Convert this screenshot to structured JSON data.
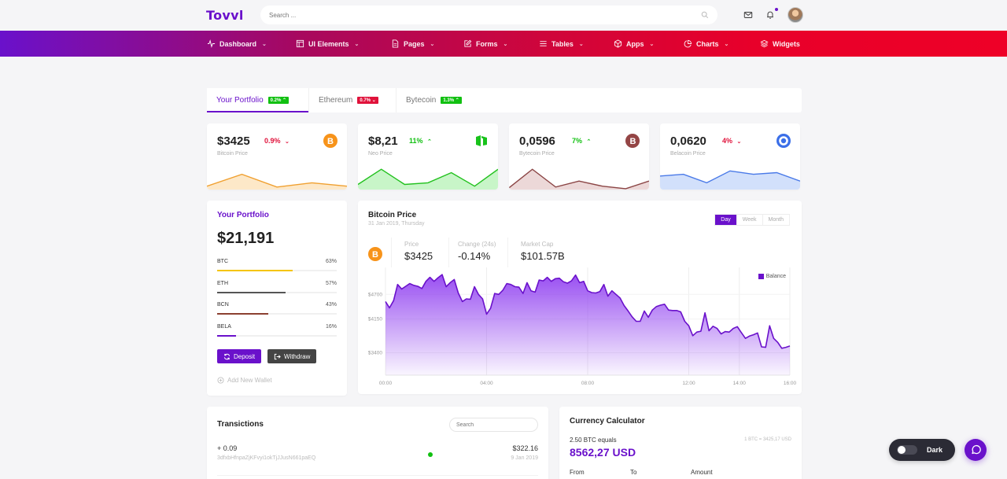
{
  "app": {
    "logo": "Tovvl"
  },
  "search": {
    "placeholder": "Search ..."
  },
  "colors": {
    "primary": "#6a11cb",
    "green": "#11c011",
    "red": "#e0123b",
    "btc": "#f7931a",
    "neo": "#18c21b",
    "bcn": "#944545",
    "bela": "#3b6fe8"
  },
  "nav": [
    {
      "label": "Dashboard",
      "icon": "activity-icon",
      "chevron": true
    },
    {
      "label": "UI Elements",
      "icon": "layout-icon",
      "chevron": true
    },
    {
      "label": "Pages",
      "icon": "file-icon",
      "chevron": true
    },
    {
      "label": "Forms",
      "icon": "edit-icon",
      "chevron": true
    },
    {
      "label": "Tables",
      "icon": "menu-icon",
      "chevron": true
    },
    {
      "label": "Apps",
      "icon": "box-icon",
      "chevron": true
    },
    {
      "label": "Charts",
      "icon": "pie-chart-icon",
      "chevron": true
    },
    {
      "label": "Widgets",
      "icon": "layers-icon",
      "chevron": false
    }
  ],
  "tabs": [
    {
      "label": "Your Portfolio",
      "badge": "0.2% ⌃",
      "trend": "up",
      "active": true
    },
    {
      "label": "Ethereum",
      "badge": "0.7% ⌄",
      "trend": "down",
      "active": false
    },
    {
      "label": "Bytecoin",
      "badge": "1.3% ⌃",
      "trend": "up",
      "active": false
    }
  ],
  "price_cards": [
    {
      "value": "$3425",
      "change": "0.9%",
      "arrow": "⌄",
      "trend": "down",
      "label": "Bitcoin Price",
      "coin": "bitcoin-icon",
      "spark": [
        2,
        9,
        1.5,
        4,
        2
      ]
    },
    {
      "value": "$8,21",
      "change": "11%",
      "arrow": "⌃",
      "trend": "up",
      "label": "Neo Price",
      "coin": "neo-icon",
      "spark": [
        3,
        12,
        3,
        4,
        10,
        2,
        12
      ]
    },
    {
      "value": "0,0596",
      "change": "7%",
      "arrow": "⌃",
      "trend": "up",
      "label": "Bytecoin Price",
      "coin": "bytecoin-icon",
      "spark": [
        1,
        12,
        1.5,
        5,
        2,
        0.5,
        5
      ]
    },
    {
      "value": "0,0620",
      "change": "4%",
      "arrow": "⌄",
      "trend": "down",
      "label": "Belacoin Price",
      "coin": "belacoin-icon",
      "spark": [
        8,
        9,
        4,
        11,
        9,
        10,
        5
      ]
    }
  ],
  "portfolio": {
    "title": "Your Portfolio",
    "total": "$21,191",
    "assets": [
      {
        "name": "BTC",
        "pct_label": "63%",
        "pct": 63,
        "color": "#f5c400"
      },
      {
        "name": "ETH",
        "pct_label": "57%",
        "pct": 57,
        "color": "#555555"
      },
      {
        "name": "BCN",
        "pct_label": "43%",
        "pct": 43,
        "color": "#8b4030"
      },
      {
        "name": "BELA",
        "pct_label": "16%",
        "pct": 16,
        "color": "#6a11cb"
      }
    ],
    "deposit": "Deposit",
    "withdraw": "Withdraw",
    "add_wallet": "Add New Wallet"
  },
  "bitcoin_panel": {
    "title": "Bitcoin Price",
    "subtitle": "31 Jan 2019, Thursday",
    "ranges": [
      "Day",
      "Week",
      "Month"
    ],
    "active_range": "Day",
    "stats": [
      {
        "label": "Price",
        "value": "$3425"
      },
      {
        "label": "Change (24s)",
        "value": "-0.14%"
      },
      {
        "label": "Market Cap",
        "value": "$101.57B"
      }
    ]
  },
  "chart_data": {
    "type": "area",
    "title": "",
    "legend": [
      "Balance"
    ],
    "legend_position": "top-right",
    "series_color": "#6a11cb",
    "x_ticks": [
      "00:00",
      "04:00",
      "08:00",
      "12:00",
      "14:00",
      "16:00"
    ],
    "y_ticks": [
      "$3400",
      "$4150",
      "$4700"
    ],
    "y_tick_values": [
      3400,
      4150,
      4700
    ],
    "ylim": [
      2900,
      5300
    ],
    "grid": true,
    "values": [
      4540,
      4400,
      4560,
      4920,
      4820,
      4880,
      4940,
      4900,
      4880,
      4830,
      4990,
      5080,
      4990,
      5070,
      5140,
      4870,
      4960,
      5030,
      4730,
      4540,
      4600,
      4590,
      4870,
      4700,
      4600,
      4260,
      4390,
      4720,
      4700,
      4790,
      4940,
      4920,
      4870,
      4860,
      4720,
      4960,
      4780,
      4750,
      5020,
      5000,
      5080,
      4990,
      5050,
      5060,
      4980,
      4950,
      5000,
      5130,
      4960,
      4990,
      4780,
      4740,
      4730,
      4760,
      4920,
      4660,
      4780,
      4700,
      4620,
      4450,
      4330,
      4200,
      4100,
      4100,
      4330,
      4190,
      4350,
      4430,
      4460,
      4480,
      4350,
      4340,
      4340,
      4310,
      4100,
      4000,
      3780,
      3860,
      3880,
      4290,
      3890,
      3990,
      3940,
      3820,
      3870,
      3860,
      3940,
      3980,
      3850,
      3720,
      3770,
      3800,
      3840,
      3530,
      3520,
      4000,
      3720,
      3630,
      3500,
      3520,
      3550
    ]
  },
  "transactions": {
    "title": "Transictions",
    "search_placeholder": "Search",
    "rows": [
      {
        "amount": "+ 0.09",
        "hash": "3dfxbHfnpaZjKFvyi1okTjJJusN661paEQ",
        "status_color": "#11c011",
        "value": "$322.16",
        "date": "9 Jan 2019"
      }
    ]
  },
  "calculator": {
    "title": "Currency Calculator",
    "equals": "2.50 BTC equals",
    "rate": "1 BTC = 3425,17 USD",
    "result": "8562,27 USD",
    "labels": [
      "From",
      "To",
      "Amount"
    ]
  },
  "theme_toggle": {
    "label": "Dark",
    "on": false
  }
}
